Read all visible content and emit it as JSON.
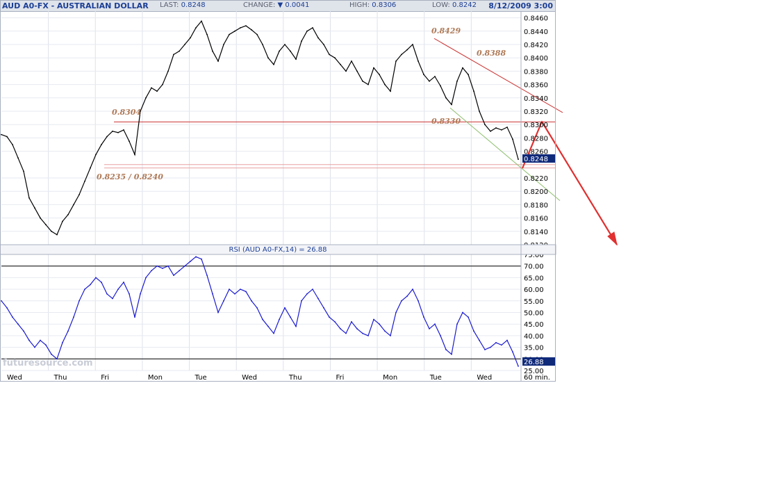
{
  "header": {
    "symbol_title": "AUD A0-FX - AUSTRALIAN DOLLAR",
    "last_label": "LAST:",
    "last_value": "0.8248",
    "change_label": "CHANGE:",
    "change_value": "0.0041",
    "high_label": "HIGH:",
    "high_value": "0.8306",
    "low_label": "LOW:",
    "low_value": "0.8242",
    "datetime": "8/12/2009 3:00"
  },
  "rsi_panel": {
    "title": "RSI (AUD A0-FX,14) = 26.88",
    "value_label": "26.88"
  },
  "watermark": "futuresource.com",
  "interval_label": "60 min.",
  "last_price_label": "0.8248",
  "annotations": [
    "0.8429",
    "0.8388",
    "0.8304",
    "0.8330",
    "0.8235 / 0.8240"
  ],
  "colors": {
    "price": "#000000",
    "rsi": "#1a1ad0",
    "trendline_red": "#cc3333",
    "trendline_green": "#8fbf6f",
    "arrow": "#e03030",
    "label_bg": "#102a7a",
    "annotation": "#b07a58"
  },
  "chart_data": [
    {
      "type": "line",
      "title": "AUD A0-FX - AUSTRALIAN DOLLAR",
      "x_labels": [
        "Wed",
        "Thu",
        "Fri",
        "Mon",
        "Tue",
        "Wed",
        "Thu",
        "Fri",
        "Mon",
        "Tue",
        "Wed"
      ],
      "ylim": [
        0.812,
        0.847
      ],
      "y_ticks": [
        "0.8460",
        "0.8440",
        "0.8420",
        "0.8400",
        "0.8380",
        "0.8360",
        "0.8340",
        "0.8320",
        "0.8300",
        "0.8280",
        "0.8260",
        "0.8220",
        "0.8200",
        "0.8180",
        "0.8160",
        "0.8140",
        "0.8120"
      ],
      "grid": true,
      "series": [
        {
          "values": [
            0.8285,
            0.8282,
            0.827,
            0.825,
            0.823,
            0.819,
            0.8175,
            0.816,
            0.815,
            0.814,
            0.8135,
            0.8155,
            0.8165,
            0.818,
            0.8195,
            0.8215,
            0.8235,
            0.8255,
            0.827,
            0.8282,
            0.829,
            0.8288,
            0.8292,
            0.8275,
            0.8255,
            0.832,
            0.834,
            0.8355,
            0.835,
            0.836,
            0.838,
            0.8405,
            0.841,
            0.842,
            0.843,
            0.8445,
            0.8455,
            0.8435,
            0.841,
            0.8395,
            0.842,
            0.8435,
            0.844,
            0.8445,
            0.8448,
            0.8442,
            0.8435,
            0.842,
            0.84,
            0.839,
            0.841,
            0.842,
            0.841,
            0.8398,
            0.8425,
            0.844,
            0.8445,
            0.843,
            0.842,
            0.8405,
            0.84,
            0.839,
            0.838,
            0.8395,
            0.838,
            0.8365,
            0.836,
            0.8385,
            0.8375,
            0.836,
            0.835,
            0.8395,
            0.8405,
            0.8412,
            0.842,
            0.8395,
            0.8375,
            0.8365,
            0.8372,
            0.8358,
            0.834,
            0.833,
            0.8365,
            0.8385,
            0.8375,
            0.835,
            0.832,
            0.83,
            0.829,
            0.8295,
            0.8292,
            0.8296,
            0.8278,
            0.8248
          ]
        }
      ]
    },
    {
      "type": "line",
      "title": "RSI (AUD A0-FX,14) = 26.88",
      "x_labels": [
        "Wed",
        "Thu",
        "Fri",
        "Mon",
        "Tue",
        "Wed",
        "Thu",
        "Fri",
        "Mon",
        "Tue",
        "Wed"
      ],
      "ylim": [
        25,
        75
      ],
      "y_ticks": [
        "75.00",
        "70.00",
        "65.00",
        "60.00",
        "55.00",
        "50.00",
        "45.00",
        "40.00",
        "35.00",
        "30.00",
        "25.00"
      ],
      "reference_lines": [
        70,
        30
      ],
      "series": [
        {
          "values": [
            55,
            52,
            48,
            45,
            42,
            38,
            35,
            38,
            36,
            32,
            30,
            37,
            42,
            48,
            55,
            60,
            62,
            65,
            63,
            58,
            56,
            60,
            63,
            58,
            48,
            58,
            65,
            68,
            70,
            69,
            70,
            66,
            68,
            70,
            72,
            74,
            73,
            66,
            58,
            50,
            55,
            60,
            58,
            60,
            59,
            55,
            52,
            47,
            44,
            41,
            47,
            52,
            48,
            44,
            55,
            58,
            60,
            56,
            52,
            48,
            46,
            43,
            41,
            46,
            43,
            41,
            40,
            47,
            45,
            42,
            40,
            50,
            55,
            57,
            60,
            55,
            48,
            43,
            45,
            40,
            34,
            32,
            45,
            50,
            48,
            42,
            38,
            34,
            35,
            37,
            36,
            38,
            33,
            26.88
          ]
        }
      ]
    }
  ]
}
